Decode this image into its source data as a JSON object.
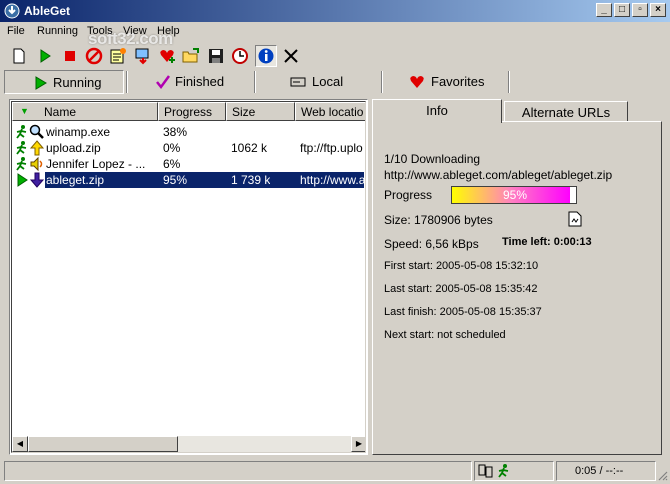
{
  "window": {
    "title": "AbleGet",
    "accent": "#0a246a"
  },
  "watermark": "soft32.com",
  "menu": [
    "File",
    "Running",
    "Tools",
    "View",
    "Help"
  ],
  "toolbar": [
    {
      "name": "new-icon"
    },
    {
      "name": "start-icon"
    },
    {
      "name": "stop-icon"
    },
    {
      "name": "cancel-icon"
    },
    {
      "name": "properties-icon"
    },
    {
      "name": "queue-icon"
    },
    {
      "name": "add-favorite-icon"
    },
    {
      "name": "open-folder-icon"
    },
    {
      "name": "save-icon"
    },
    {
      "name": "scheduler-icon"
    },
    {
      "name": "info-icon"
    },
    {
      "name": "delete-icon"
    }
  ],
  "categories": [
    "Running",
    "Finished",
    "Local",
    "Favorites"
  ],
  "list": {
    "columns": [
      "Name",
      "Progress",
      "Size",
      "Web locatio"
    ],
    "rows": [
      {
        "name": "winamp.exe",
        "progress": "38%",
        "size": "",
        "url": ""
      },
      {
        "name": "upload.zip",
        "progress": "0%",
        "size": "1062 k",
        "url": "ftp://ftp.uplo"
      },
      {
        "name": "Jennifer Lopez - ...",
        "progress": "6%",
        "size": "",
        "url": ""
      },
      {
        "name": "ableget.zip",
        "progress": "95%",
        "size": "1 739 k",
        "url": "http://www.a"
      }
    ]
  },
  "panel": {
    "tabs": [
      "Info",
      "Alternate URLs"
    ],
    "downloading": "1/10 Downloading",
    "url": "http://www.ableget.com/ableget/ableget.zip",
    "progress_label": "Progress",
    "progress_value": "95%",
    "progress_fraction": 0.95,
    "size": "Size: 1780906 bytes",
    "speed": "Speed: 6,56 kBps",
    "time_left": "Time left: 0:00:13",
    "first_start": "First start: 2005-05-08 15:32:10",
    "last_start": "Last start: 2005-05-08 15:35:42",
    "last_finish": "Last finish: 2005-05-08 15:35:37",
    "next_start": "Next start: not scheduled"
  },
  "status": {
    "time": "0:05 / --:--"
  }
}
